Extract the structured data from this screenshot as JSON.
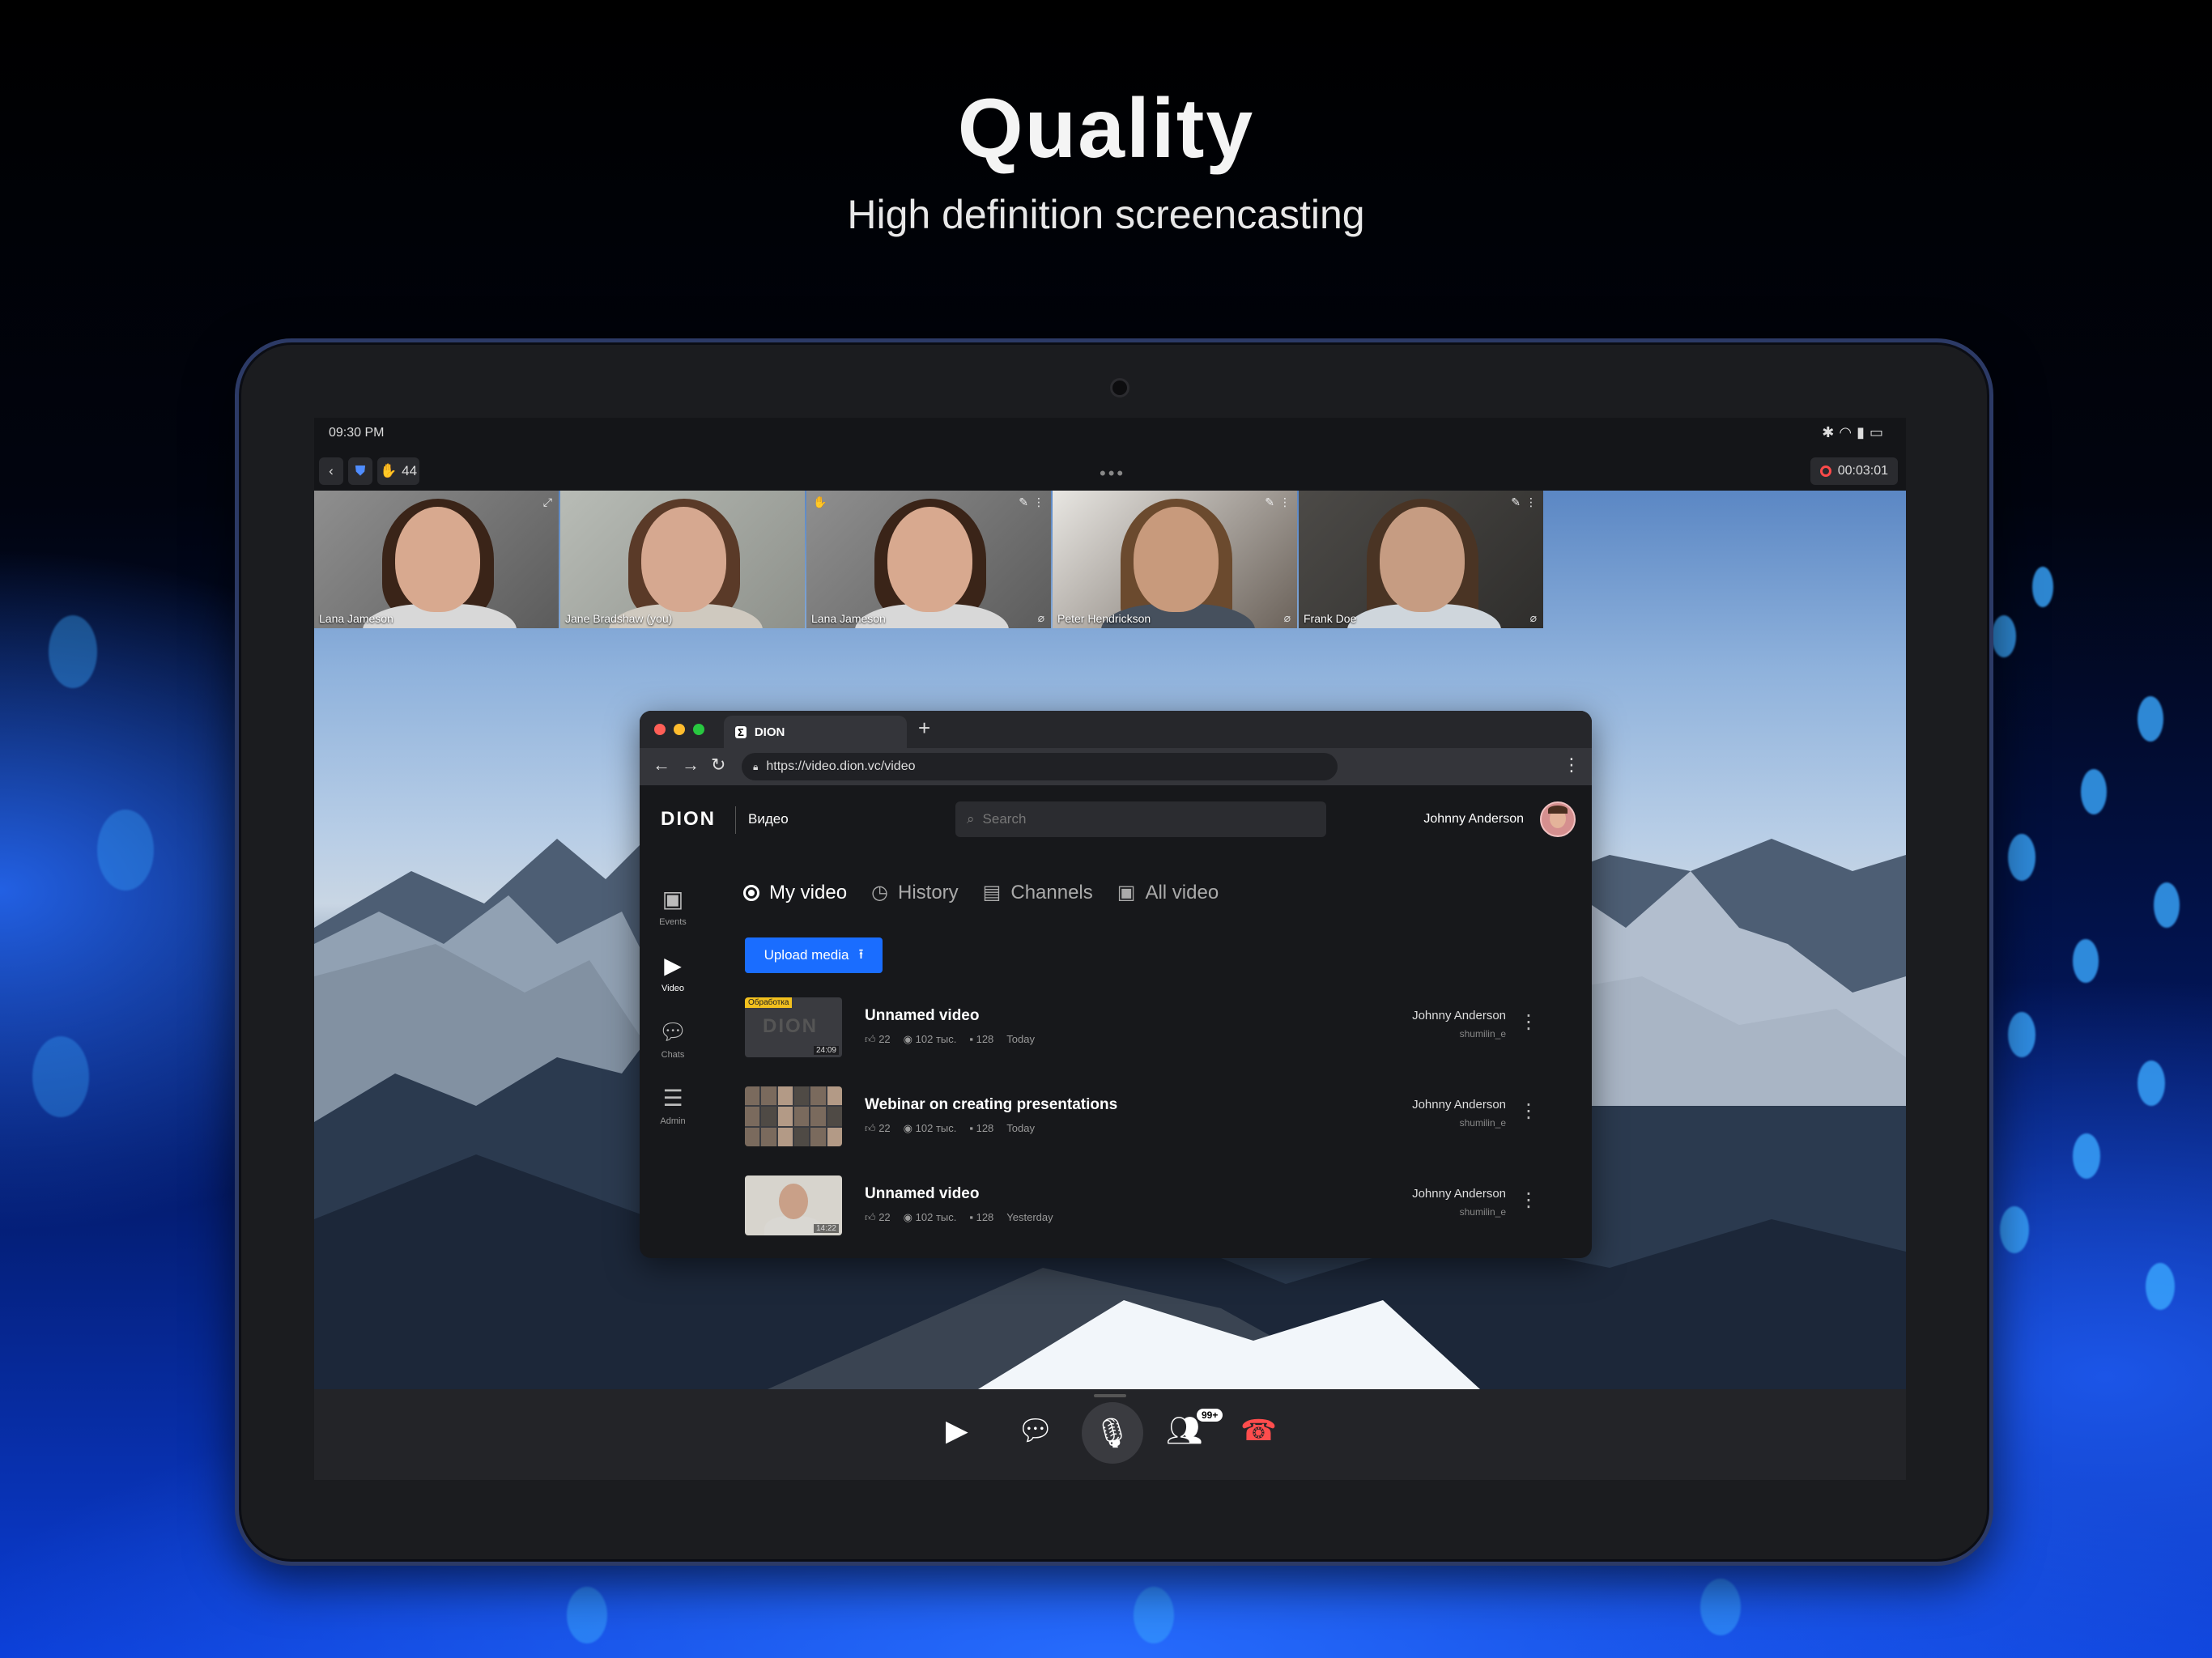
{
  "hero": {
    "title": "Quality",
    "subtitle": "High definition screencasting"
  },
  "status_bar": {
    "time": "09:30 PM",
    "icons": [
      "bluetooth-icon",
      "wifi-icon",
      "signal-icon",
      "battery-icon"
    ]
  },
  "call_bar": {
    "participants_count": "44",
    "recording_time": "00:03:01"
  },
  "participants": [
    {
      "name": "Lana Jameson"
    },
    {
      "name": "Jane Bradshaw (you)"
    },
    {
      "name": "Lana Jameson"
    },
    {
      "name": "Peter Hendrickson"
    },
    {
      "name": "Frank Doe"
    }
  ],
  "browser": {
    "tab_title": "DION",
    "url": "https://video.dion.vc/video",
    "app": {
      "logo": "DION",
      "section": "Видео",
      "search_placeholder": "Search",
      "user_name": "Johnny Anderson",
      "sidenav": [
        "Events",
        "Video",
        "Chats",
        "Admin"
      ],
      "tabs": [
        "My video",
        "History",
        "Channels",
        "All video"
      ],
      "upload_label": "Upload media",
      "videos": [
        {
          "title": "Unnamed video",
          "likes": "22",
          "views": "102 тыс.",
          "comments": "128",
          "date": "Today",
          "author": "Johnny Anderson",
          "handle": "shumilin_e",
          "badge": "Обработка",
          "duration": "24:09",
          "thumb_text": "DION"
        },
        {
          "title": "Webinar on creating presentations",
          "likes": "22",
          "views": "102 тыс.",
          "comments": "128",
          "date": "Today",
          "author": "Johnny Anderson",
          "handle": "shumilin_e"
        },
        {
          "title": "Unnamed video",
          "likes": "22",
          "views": "102 тыс.",
          "comments": "128",
          "date": "Yesterday",
          "author": "Johnny Anderson",
          "handle": "shumilin_e",
          "duration": "14:22"
        }
      ]
    }
  },
  "controls": {
    "participants_badge": "99+"
  },
  "colors": {
    "accent": "#1a6dff",
    "record": "#ff4a4a",
    "hangup": "#ff4d4d"
  }
}
